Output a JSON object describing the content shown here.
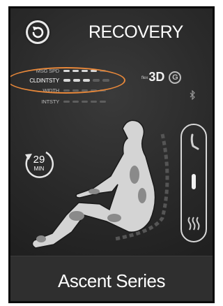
{
  "header": {
    "title": "RECOVERY",
    "back_icon": "refresh-back-icon"
  },
  "params": [
    {
      "label": "MSG SPD",
      "level": 4,
      "max": 5
    },
    {
      "label": "CLDINTSTY",
      "level": 3,
      "max": 5
    },
    {
      "label": "WIDTH",
      "level": 0,
      "max": 5
    },
    {
      "label": "INTSTY",
      "level": 0,
      "max": 5
    }
  ],
  "mode": {
    "small": "flex",
    "big": "3D",
    "badge": "G"
  },
  "timer": {
    "minutes": "29",
    "unit": "MIN"
  },
  "footer": {
    "series": "Ascent Series"
  },
  "colors": {
    "highlight": "#e8883a",
    "background": "#2a2a2a",
    "text": "#ffffff"
  },
  "icons": [
    "refresh-back-icon",
    "bluetooth-icon",
    "timer-arrow-icon",
    "recline-seat-icon",
    "position-slider-icon",
    "heat-waves-icon"
  ]
}
